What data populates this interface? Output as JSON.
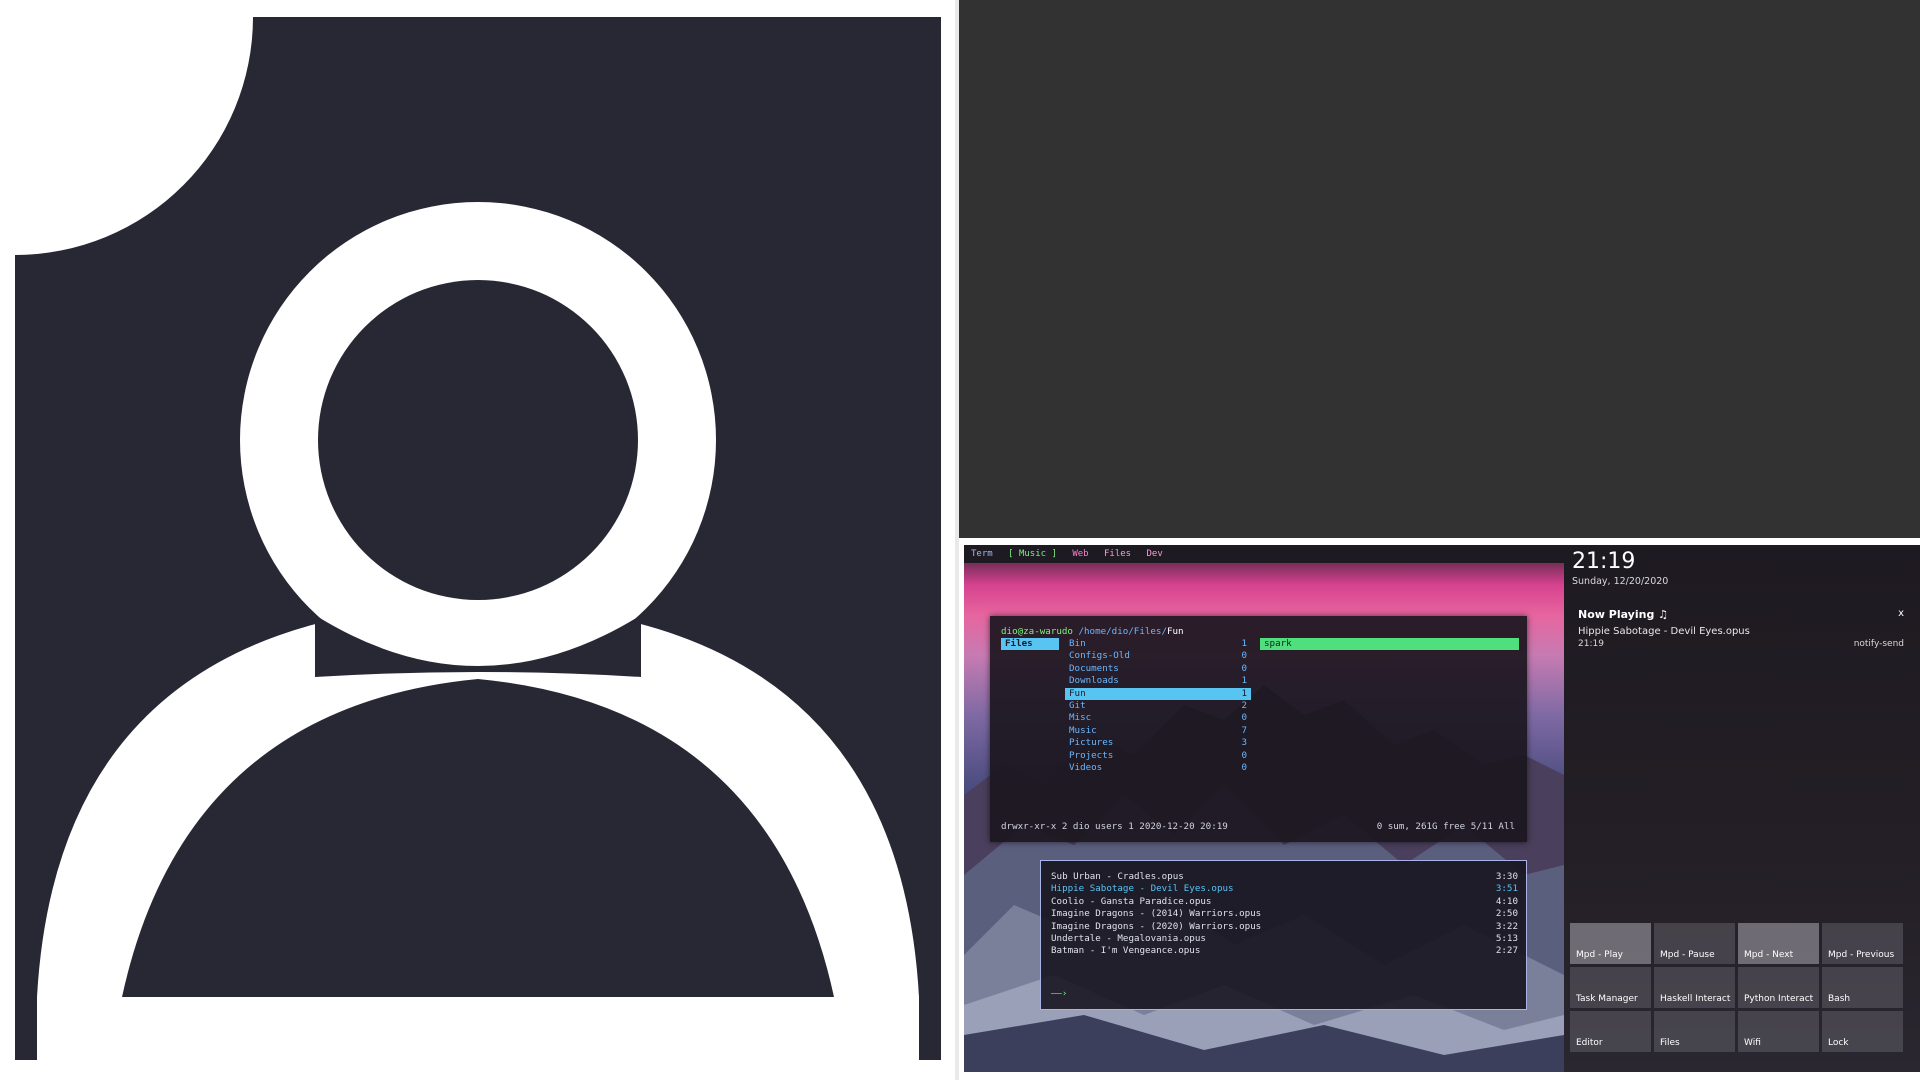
{
  "avatar": {
    "icon": "user-icon",
    "background": "#272833",
    "foreground": "#ffffff"
  },
  "workspaces": [
    {
      "label": "Term",
      "active": false
    },
    {
      "label": "[ Music ]",
      "active": true
    },
    {
      "label": "Web",
      "active": false
    },
    {
      "label": "Files",
      "active": false
    },
    {
      "label": "Dev",
      "active": false
    }
  ],
  "ranger": {
    "user": "dio@za-warudo",
    "path": "/home/dio/Files/",
    "current": "Fun",
    "parent_column": "Files",
    "entries": [
      {
        "name": "Bin",
        "count": "1"
      },
      {
        "name": "Configs-Old",
        "count": "0"
      },
      {
        "name": "Documents",
        "count": "0"
      },
      {
        "name": "Downloads",
        "count": "1"
      },
      {
        "name": "Fun",
        "count": "1",
        "selected": true
      },
      {
        "name": "Git",
        "count": "2"
      },
      {
        "name": "Misc",
        "count": "0"
      },
      {
        "name": "Music",
        "count": "7"
      },
      {
        "name": "Pictures",
        "count": "3"
      },
      {
        "name": "Projects",
        "count": "0"
      },
      {
        "name": "Videos",
        "count": "0"
      }
    ],
    "preview": "spark",
    "status_left": "drwxr-xr-x 2 dio users 1 2020-12-20 20:19",
    "status_right": "0 sum, 261G free  5/11  All"
  },
  "playlist": {
    "tracks": [
      {
        "title": "Sub Urban - Cradles.opus",
        "duration": "3:30",
        "playing": false
      },
      {
        "title": "Hippie Sabotage - Devil Eyes.opus",
        "duration": "3:51",
        "playing": true
      },
      {
        "title": "Coolio - Gansta Paradice.opus",
        "duration": "4:10",
        "playing": false
      },
      {
        "title": "Imagine Dragons - (2014) Warriors.opus",
        "duration": "2:50",
        "playing": false
      },
      {
        "title": "Imagine Dragons - (2020) Warriors.opus",
        "duration": "3:22",
        "playing": false
      },
      {
        "title": "Undertale - Megalovania.opus",
        "duration": "5:13",
        "playing": false
      },
      {
        "title": "Batman - I'm Vengeance.opus",
        "duration": "2:27",
        "playing": false
      }
    ],
    "progress_bar": "——›"
  },
  "sidebar": {
    "clock": "21:19",
    "date": "Sunday, 12/20/2020",
    "notification": {
      "title": "Now Playing ♫",
      "close": "x",
      "body": "Hippie Sabotage - Devil Eyes.opus",
      "time": "21:19",
      "app": "notify-send"
    },
    "buttons": [
      {
        "label": "Mpd - Play",
        "active": true
      },
      {
        "label": "Mpd - Pause",
        "active": false
      },
      {
        "label": "Mpd - Next",
        "active": true
      },
      {
        "label": "Mpd - Previous",
        "active": false
      },
      {
        "label": "Task Manager",
        "active": false
      },
      {
        "label": "Haskell Interact",
        "active": false
      },
      {
        "label": "Python Interact",
        "active": false
      },
      {
        "label": "Bash",
        "active": false
      },
      {
        "label": "Editor",
        "active": false
      },
      {
        "label": "Files",
        "active": false
      },
      {
        "label": "Wifi",
        "active": false
      },
      {
        "label": "Lock",
        "active": false
      }
    ]
  }
}
